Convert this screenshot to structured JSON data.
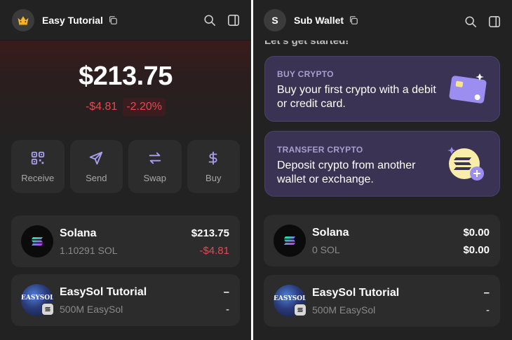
{
  "left": {
    "account_name": "Easy Tutorial",
    "avatar": "crown-emoji",
    "balance": "$213.75",
    "change_value": "-$4.81",
    "change_percent": "-2.20%",
    "actions": [
      "Receive",
      "Send",
      "Swap",
      "Buy"
    ],
    "tokens": [
      {
        "name": "Solana",
        "amount": "1.10291 SOL",
        "value": "$213.75",
        "change": "-$4.81"
      },
      {
        "name": "EasySol Tutorial",
        "amount": "500M EasySol",
        "value": "–",
        "change": "-",
        "logo_text": "EASYSOL"
      }
    ]
  },
  "right": {
    "account_initial": "S",
    "account_name": "Sub Wallet",
    "partial_heading": "Let's get started!",
    "promos": [
      {
        "label": "BUY CRYPTO",
        "desc": "Buy your first crypto with a debit or credit card."
      },
      {
        "label": "TRANSFER CRYPTO",
        "desc": "Deposit crypto from another wallet or exchange."
      }
    ],
    "tokens": [
      {
        "name": "Solana",
        "amount": "0 SOL",
        "value": "$0.00",
        "change": "$0.00"
      },
      {
        "name": "EasySol Tutorial",
        "amount": "500M EasySol",
        "value": "–",
        "change": "-",
        "logo_text": "EASYSOL"
      }
    ]
  },
  "colors": {
    "background": "#222222",
    "card": "#2c2c2c",
    "negative": "#e8484d",
    "accent": "#ab9ff2",
    "promo": "#3a3354"
  }
}
